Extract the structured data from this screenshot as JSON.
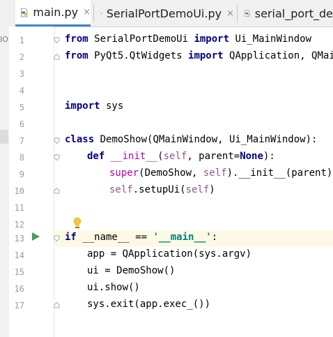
{
  "tabs": [
    {
      "label": "main.py",
      "active": true,
      "close": "×"
    },
    {
      "label": "SerialPortDemoUi.py",
      "active": false,
      "close": "×"
    },
    {
      "label": "serial_port_de",
      "active": false,
      "close": ""
    }
  ],
  "left_strip_text": "IO",
  "current_line": 13,
  "line_numbers": [
    "1",
    "2",
    "3",
    "4",
    "5",
    "6",
    "7",
    "8",
    "9",
    "10",
    "11",
    "12",
    "13",
    "14",
    "15",
    "16",
    "17"
  ],
  "code": {
    "l1": {
      "kw1": "from",
      "t1": " SerialPortDemoUi ",
      "kw2": "import",
      "t2": " Ui_MainWindow"
    },
    "l2": {
      "kw1": "from",
      "t1": " PyQt5.QtWidgets ",
      "kw2": "import",
      "t2": " QApplication, QMainW"
    },
    "l5": {
      "kw1": "import",
      "t1": " sys"
    },
    "l7": {
      "kw1": "class",
      "t1": " DemoShow(QMainWindow, Ui_MainWindow):"
    },
    "l8": {
      "kw1": "def",
      "sp": " ",
      "magic": "__init__",
      "t1": "(",
      "self": "self",
      "t2": ", parent=",
      "kw2": "None",
      "t3": "):"
    },
    "l9": {
      "magic": "super",
      "t1": "(DemoShow, ",
      "self": "self",
      "t2": ").__init__(parent)"
    },
    "l10": {
      "self1": "self",
      "t1": ".setupUi(",
      "self2": "self",
      "t2": ")"
    },
    "l13": {
      "kw1": "if",
      "t1": " __name__ == ",
      "str": "'__main__'",
      "t2": ":"
    },
    "l14": {
      "t1": "app = QApplication(sys.argv)"
    },
    "l15": {
      "t1": "ui = DemoShow()"
    },
    "l16": {
      "t1": "ui.show()"
    },
    "l17": {
      "t1": "sys.exit(app.exec_())"
    }
  },
  "colors": {
    "keyword": "#000080",
    "self": "#94558d",
    "magic": "#b200b2",
    "string": "#008080",
    "current_line_bg": "#fcfae4",
    "run_icon": "#499c54"
  },
  "icons": [
    "python-file-icon",
    "close-icon",
    "run-icon",
    "lightbulb-icon",
    "fold-icon"
  ]
}
